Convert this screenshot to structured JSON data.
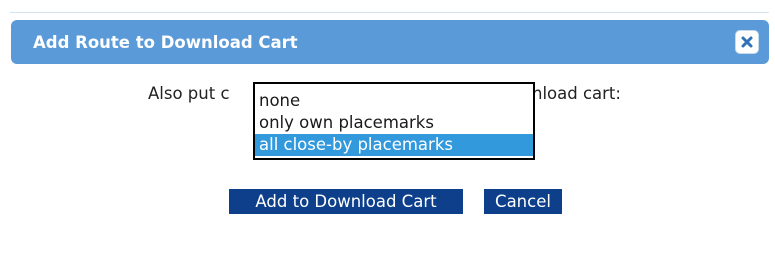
{
  "dialog": {
    "title": "Add Route to Download Cart",
    "close_icon": "close-icon"
  },
  "prompt": {
    "left_visible": "Also put c",
    "right_visible": "nload cart:"
  },
  "placemark_select": {
    "options": [
      {
        "label": "none"
      },
      {
        "label": "only own placemarks"
      },
      {
        "label": "all close-by placemarks"
      }
    ],
    "selected_index": 2
  },
  "buttons": {
    "add_label": "Add to Download Cart",
    "cancel_label": "Cancel"
  },
  "colors": {
    "titlebar": "#5a9ad8",
    "button": "#0d3f8a",
    "selection": "#3399dd"
  }
}
